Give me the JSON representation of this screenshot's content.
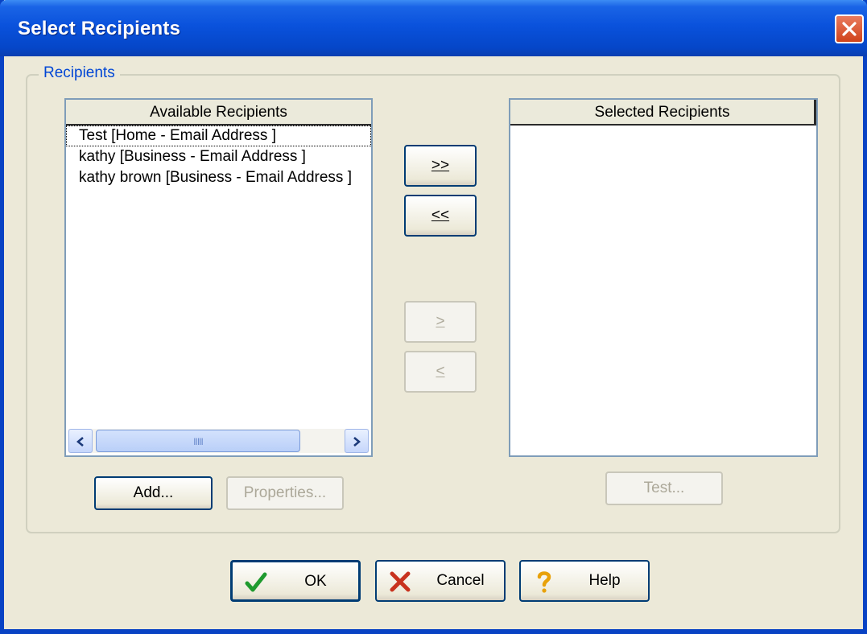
{
  "window": {
    "title": "Select Recipients"
  },
  "group": {
    "legend": "Recipients"
  },
  "available": {
    "header": "Available Recipients",
    "items": [
      "Test  [Home - Email Address ]",
      "kathy  [Business - Email Address ]",
      "kathy brown  [Business - Email Address ]"
    ],
    "scrollbar_grip": "IIIII"
  },
  "selected": {
    "header": "Selected Recipients",
    "items": []
  },
  "transfer": {
    "add_all_label": ">>",
    "remove_all_label": "<<",
    "add_one_label": ">",
    "remove_one_label": "<"
  },
  "buttons": {
    "add": "Add...",
    "properties": "Properties...",
    "test": "Test...",
    "ok": "OK",
    "cancel": "Cancel",
    "help": "Help"
  },
  "icons": {
    "close": "close-icon",
    "ok": "checkmark-icon",
    "cancel": "x-icon",
    "help": "question-icon"
  },
  "colors": {
    "titlebar": "#0a52dc",
    "face": "#ece9d8",
    "legend": "#0046d5"
  }
}
